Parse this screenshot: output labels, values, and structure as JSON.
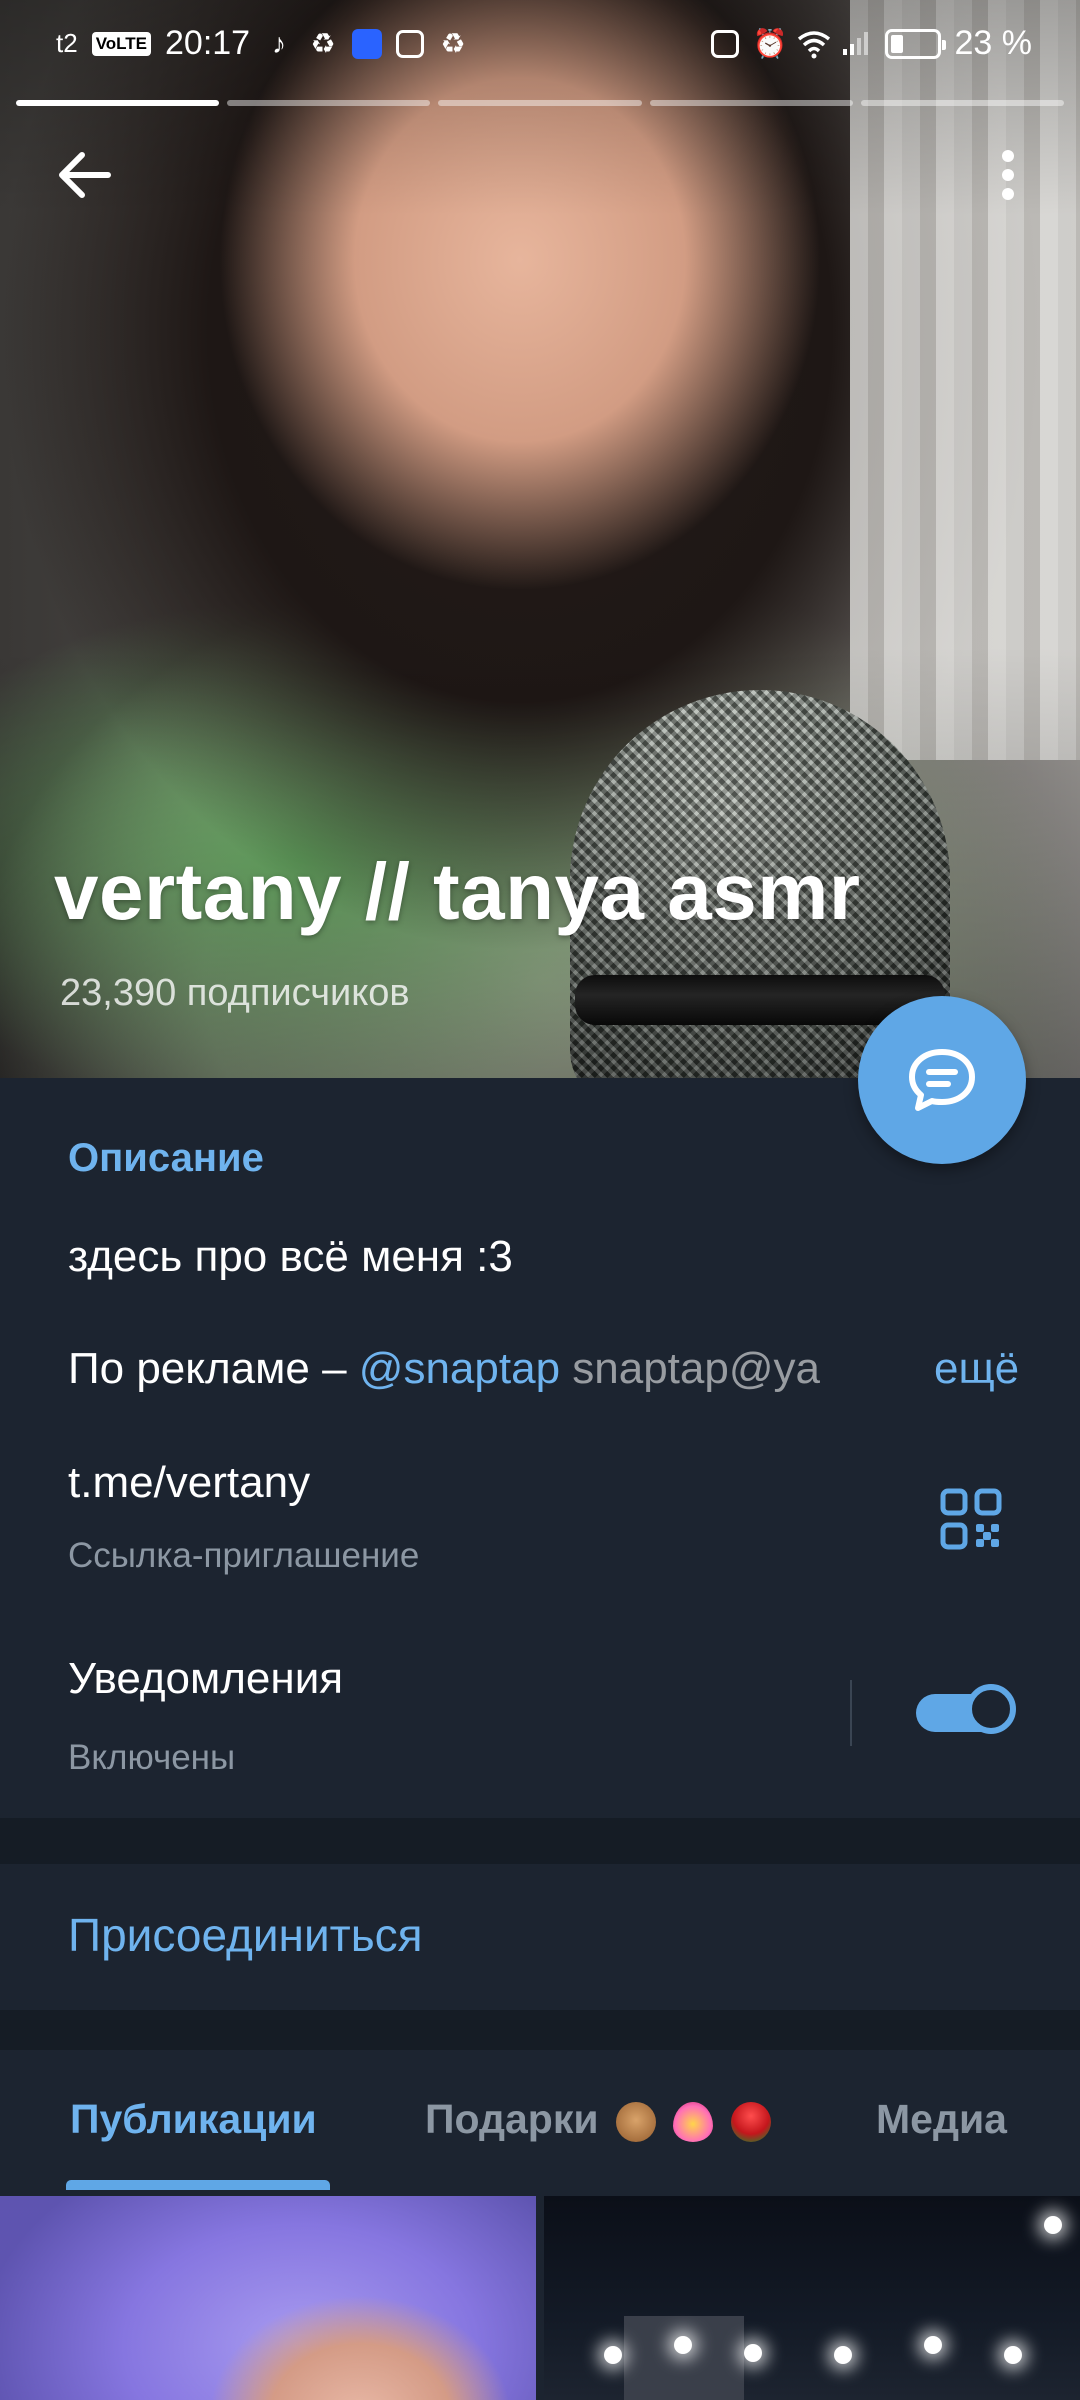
{
  "status_bar": {
    "carrier": "t2",
    "volte": "VoLTE",
    "time": "20:17",
    "battery": "23 %"
  },
  "channel": {
    "title": "vertany // tanya asmr",
    "subscribers": "23,390 подписчиков"
  },
  "info": {
    "description_label": "Описание",
    "description_line1": "здесь про всё меня :3",
    "description_line2_prefix": "По рекламе – ",
    "description_line2_link": "@snaptap",
    "description_line2_rest": " snaptap@ya",
    "more_label": "ещё",
    "link": "t.me/vertany",
    "link_caption": "Ссылка-приглашение",
    "notifications_label": "Уведомления",
    "notifications_status": "Включены"
  },
  "join_label": "Присоединиться",
  "tabs": {
    "publications": "Публикации",
    "gifts": "Подарки",
    "media": "Медиа"
  },
  "colors": {
    "accent": "#5fa7e6",
    "link": "#6fb3ee",
    "background": "#1c2430",
    "secondary_text": "#8c97a3"
  },
  "icons": [
    "back-arrow-icon",
    "more-vertical-icon",
    "chat-bubble-icon",
    "qr-code-icon",
    "notification-toggle"
  ]
}
